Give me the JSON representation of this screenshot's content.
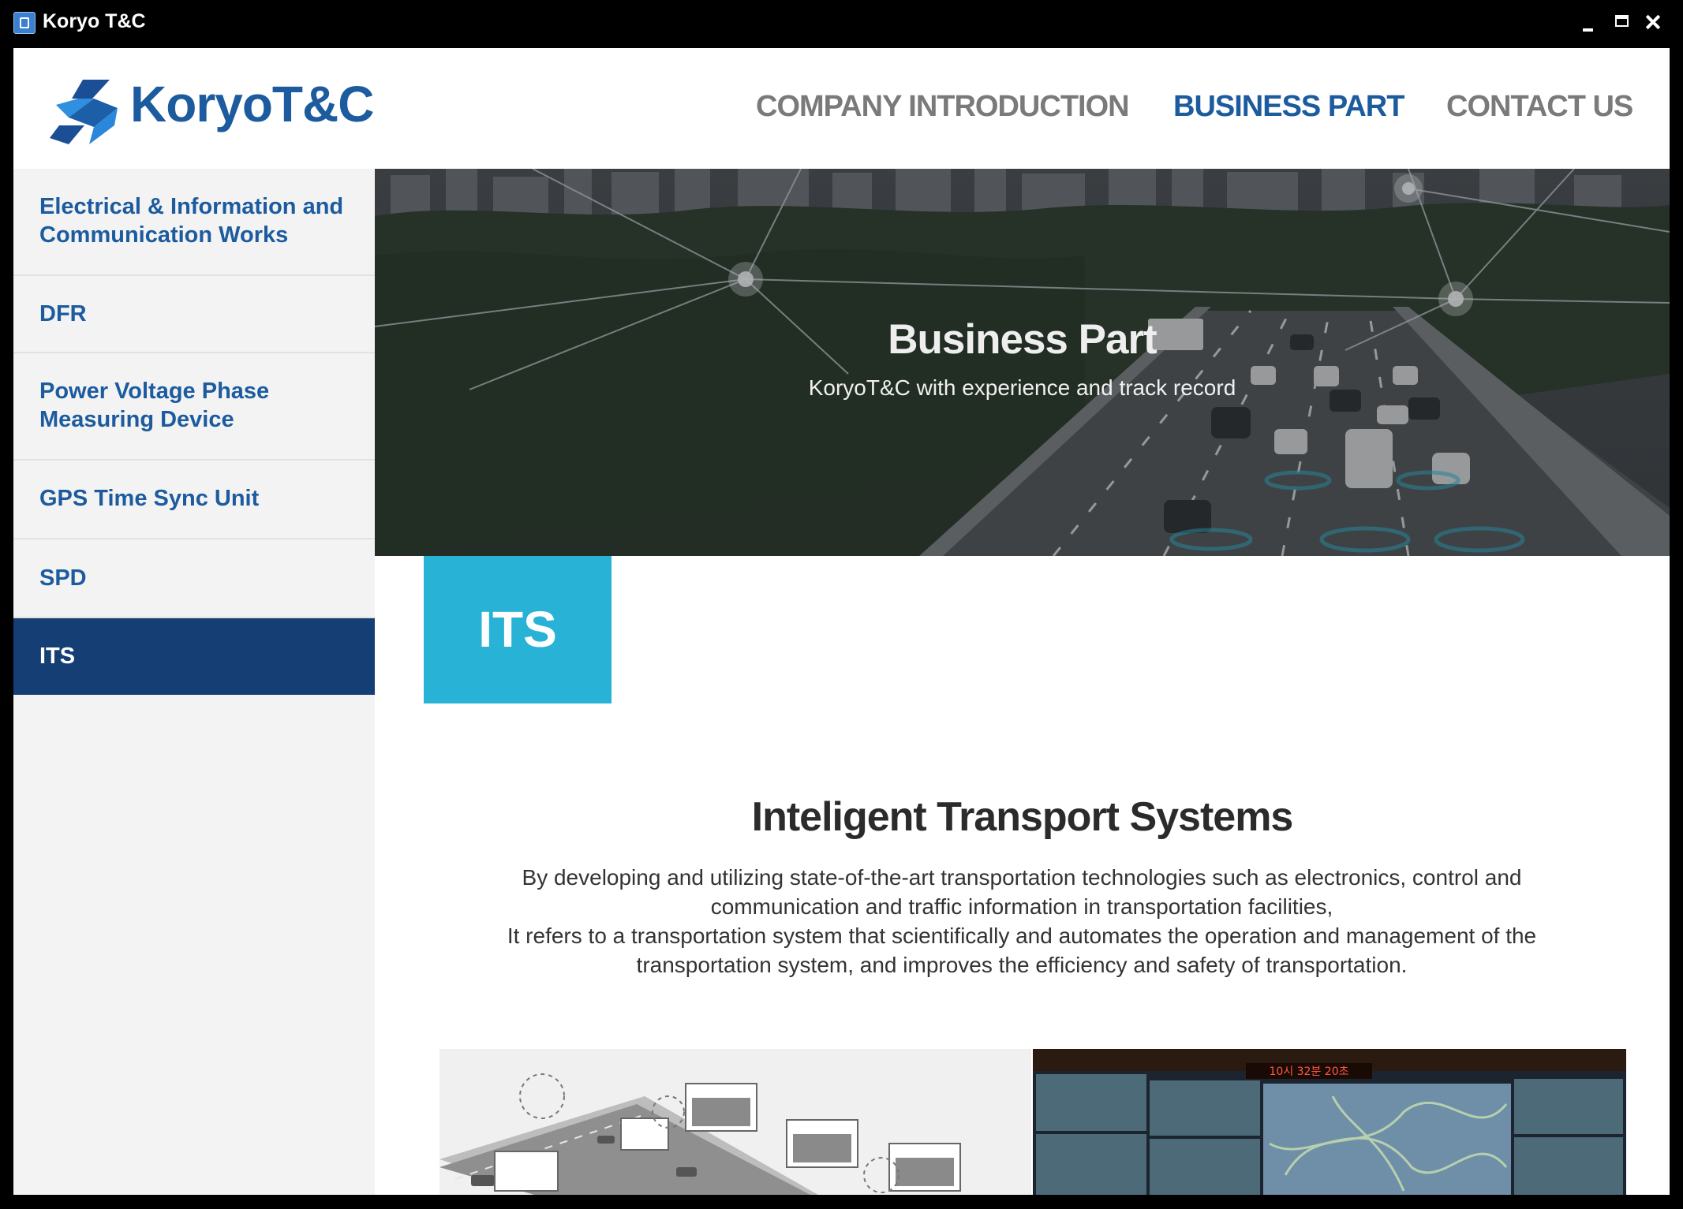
{
  "window": {
    "title": "Koryo T&C"
  },
  "header": {
    "logo_text": "KoryoT&C",
    "nav": {
      "company": "COMPANY INTRODUCTION",
      "business": "BUSINESS PART",
      "contact": "CONTACT US"
    }
  },
  "sidebar": {
    "items": [
      {
        "line1": "Electrical & Information and",
        "line2": "Communication Works"
      },
      {
        "line1": "DFR"
      },
      {
        "line1": "Power Voltage Phase",
        "line2": "Measuring Device"
      },
      {
        "line1": "GPS Time Sync Unit"
      },
      {
        "line1": "SPD"
      },
      {
        "line1": "ITS"
      }
    ],
    "active_index": 5
  },
  "hero": {
    "title": "Business Part",
    "subtitle": "KoryoT&C with experience and track record"
  },
  "section": {
    "badge": "ITS",
    "title": "Inteligent Transport Systems",
    "body": [
      "By developing and utilizing state-of-the-art transportation technologies such as electronics, control and",
      "communication and traffic information in transportation facilities,",
      "It refers to a transportation system that scientifically and automates the operation and management of the",
      "transportation system, and improves the efficiency and safety of transportation."
    ]
  },
  "photos": {
    "control_room_sign": "10시 32분 20초"
  },
  "colors": {
    "brand_blue": "#1c5b9e",
    "active_nav_bg": "#153f74",
    "its_badge": "#28b2d6",
    "sidebar_bg": "#f3f3f3"
  }
}
